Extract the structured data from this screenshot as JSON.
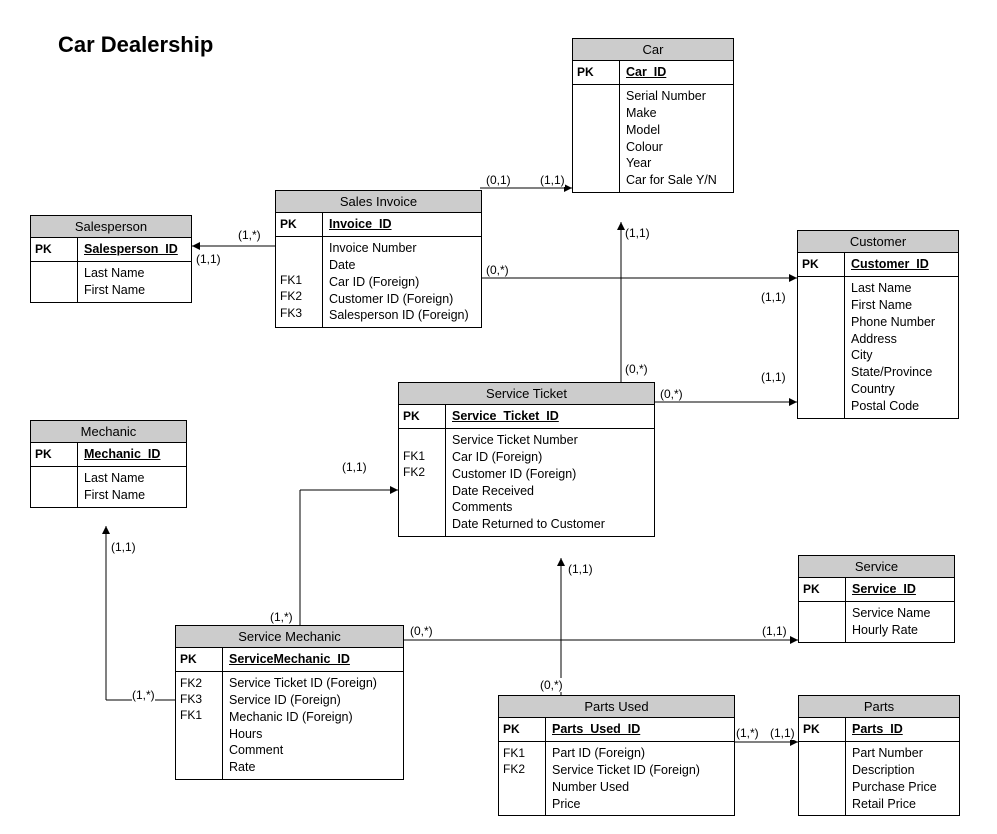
{
  "title": "Car Dealership",
  "entities": {
    "salesperson": {
      "name": "Salesperson",
      "pk": "Salesperson_ID",
      "attrs": [
        "Last Name",
        "First Name"
      ]
    },
    "sales_invoice": {
      "name": "Sales Invoice",
      "pk": "Invoice_ID",
      "fk_labels": [
        "",
        "",
        "FK1",
        "FK2",
        "FK3"
      ],
      "attrs": [
        "Invoice Number",
        "Date",
        "Car ID (Foreign)",
        "Customer ID (Foreign)",
        "Salesperson ID (Foreign)"
      ]
    },
    "car": {
      "name": "Car",
      "pk": "Car_ID",
      "attrs": [
        "Serial Number",
        "Make",
        "Model",
        "Colour",
        "Year",
        "Car for Sale Y/N"
      ]
    },
    "customer": {
      "name": "Customer",
      "pk": "Customer_ID",
      "attrs": [
        "Last Name",
        "First Name",
        "Phone Number",
        "Address",
        "City",
        "State/Province",
        "Country",
        "Postal Code"
      ]
    },
    "service_ticket": {
      "name": "Service Ticket",
      "pk": "Service_Ticket_ID",
      "fk_labels": [
        "",
        "FK1",
        "FK2",
        "",
        "",
        ""
      ],
      "attrs": [
        "Service Ticket Number",
        "Car ID (Foreign)",
        "Customer ID (Foreign)",
        "Date Received",
        "Comments",
        "Date Returned to Customer"
      ]
    },
    "mechanic": {
      "name": "Mechanic",
      "pk": "Mechanic_ID",
      "attrs": [
        "Last Name",
        "First Name"
      ]
    },
    "service_mechanic": {
      "name": "Service Mechanic",
      "pk": "ServiceMechanic_ID",
      "fk_labels": [
        "FK2",
        "FK3",
        "FK1",
        "",
        "",
        ""
      ],
      "attrs": [
        "Service Ticket ID (Foreign)",
        "Service ID (Foreign)",
        "Mechanic ID (Foreign)",
        "Hours",
        "Comment",
        "Rate"
      ]
    },
    "service": {
      "name": "Service",
      "pk": "Service_ID",
      "attrs": [
        "Service Name",
        "Hourly Rate"
      ]
    },
    "parts_used": {
      "name": "Parts Used",
      "pk": "Parts_Used_ID",
      "fk_labels": [
        "FK1",
        "FK2",
        "",
        ""
      ],
      "attrs": [
        "Part ID (Foreign)",
        "Service Ticket ID (Foreign)",
        "Number Used",
        "Price"
      ]
    },
    "parts": {
      "name": "Parts",
      "pk": "Parts_ID",
      "attrs": [
        "Part Number",
        "Description",
        "Purchase Price",
        "Retail Price"
      ]
    }
  },
  "cardinalities": {
    "c1": "(1,*)",
    "c2": "(1,1)",
    "c3": "(0,1)",
    "c4": "(1,1)",
    "c5": "(0,*)",
    "c6": "(1,1)",
    "c7": "(1,1)",
    "c8": "(0,*)",
    "c9": "(1,1)",
    "c10": "(0,*)",
    "c11": "(1,1)",
    "c12": "(1,*)",
    "c13": "(1,*)",
    "c14": "(1,1)",
    "c15": "(0,*)",
    "c16": "(1,1)",
    "c17": "(0,*)",
    "c18": "(1,1)",
    "c19": "(1,*)",
    "c20": "(1,1)"
  }
}
